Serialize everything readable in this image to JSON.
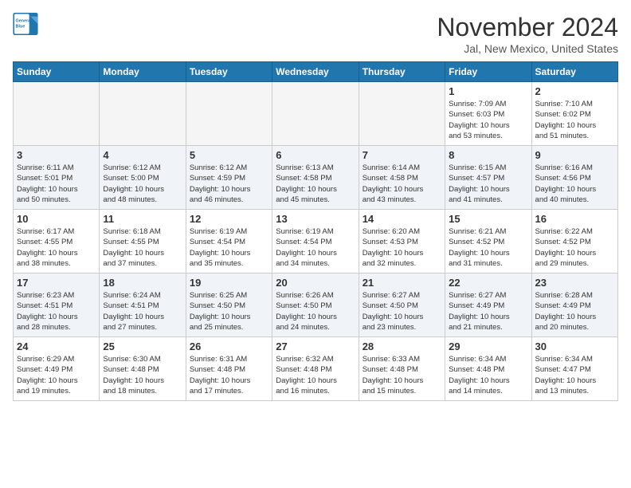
{
  "logo": {
    "line1": "General",
    "line2": "Blue"
  },
  "title": "November 2024",
  "subtitle": "Jal, New Mexico, United States",
  "days_of_week": [
    "Sunday",
    "Monday",
    "Tuesday",
    "Wednesday",
    "Thursday",
    "Friday",
    "Saturday"
  ],
  "weeks": [
    [
      {
        "day": "",
        "info": ""
      },
      {
        "day": "",
        "info": ""
      },
      {
        "day": "",
        "info": ""
      },
      {
        "day": "",
        "info": ""
      },
      {
        "day": "",
        "info": ""
      },
      {
        "day": "1",
        "info": "Sunrise: 7:09 AM\nSunset: 6:03 PM\nDaylight: 10 hours\nand 53 minutes."
      },
      {
        "day": "2",
        "info": "Sunrise: 7:10 AM\nSunset: 6:02 PM\nDaylight: 10 hours\nand 51 minutes."
      }
    ],
    [
      {
        "day": "3",
        "info": "Sunrise: 6:11 AM\nSunset: 5:01 PM\nDaylight: 10 hours\nand 50 minutes."
      },
      {
        "day": "4",
        "info": "Sunrise: 6:12 AM\nSunset: 5:00 PM\nDaylight: 10 hours\nand 48 minutes."
      },
      {
        "day": "5",
        "info": "Sunrise: 6:12 AM\nSunset: 4:59 PM\nDaylight: 10 hours\nand 46 minutes."
      },
      {
        "day": "6",
        "info": "Sunrise: 6:13 AM\nSunset: 4:58 PM\nDaylight: 10 hours\nand 45 minutes."
      },
      {
        "day": "7",
        "info": "Sunrise: 6:14 AM\nSunset: 4:58 PM\nDaylight: 10 hours\nand 43 minutes."
      },
      {
        "day": "8",
        "info": "Sunrise: 6:15 AM\nSunset: 4:57 PM\nDaylight: 10 hours\nand 41 minutes."
      },
      {
        "day": "9",
        "info": "Sunrise: 6:16 AM\nSunset: 4:56 PM\nDaylight: 10 hours\nand 40 minutes."
      }
    ],
    [
      {
        "day": "10",
        "info": "Sunrise: 6:17 AM\nSunset: 4:55 PM\nDaylight: 10 hours\nand 38 minutes."
      },
      {
        "day": "11",
        "info": "Sunrise: 6:18 AM\nSunset: 4:55 PM\nDaylight: 10 hours\nand 37 minutes."
      },
      {
        "day": "12",
        "info": "Sunrise: 6:19 AM\nSunset: 4:54 PM\nDaylight: 10 hours\nand 35 minutes."
      },
      {
        "day": "13",
        "info": "Sunrise: 6:19 AM\nSunset: 4:54 PM\nDaylight: 10 hours\nand 34 minutes."
      },
      {
        "day": "14",
        "info": "Sunrise: 6:20 AM\nSunset: 4:53 PM\nDaylight: 10 hours\nand 32 minutes."
      },
      {
        "day": "15",
        "info": "Sunrise: 6:21 AM\nSunset: 4:52 PM\nDaylight: 10 hours\nand 31 minutes."
      },
      {
        "day": "16",
        "info": "Sunrise: 6:22 AM\nSunset: 4:52 PM\nDaylight: 10 hours\nand 29 minutes."
      }
    ],
    [
      {
        "day": "17",
        "info": "Sunrise: 6:23 AM\nSunset: 4:51 PM\nDaylight: 10 hours\nand 28 minutes."
      },
      {
        "day": "18",
        "info": "Sunrise: 6:24 AM\nSunset: 4:51 PM\nDaylight: 10 hours\nand 27 minutes."
      },
      {
        "day": "19",
        "info": "Sunrise: 6:25 AM\nSunset: 4:50 PM\nDaylight: 10 hours\nand 25 minutes."
      },
      {
        "day": "20",
        "info": "Sunrise: 6:26 AM\nSunset: 4:50 PM\nDaylight: 10 hours\nand 24 minutes."
      },
      {
        "day": "21",
        "info": "Sunrise: 6:27 AM\nSunset: 4:50 PM\nDaylight: 10 hours\nand 23 minutes."
      },
      {
        "day": "22",
        "info": "Sunrise: 6:27 AM\nSunset: 4:49 PM\nDaylight: 10 hours\nand 21 minutes."
      },
      {
        "day": "23",
        "info": "Sunrise: 6:28 AM\nSunset: 4:49 PM\nDaylight: 10 hours\nand 20 minutes."
      }
    ],
    [
      {
        "day": "24",
        "info": "Sunrise: 6:29 AM\nSunset: 4:49 PM\nDaylight: 10 hours\nand 19 minutes."
      },
      {
        "day": "25",
        "info": "Sunrise: 6:30 AM\nSunset: 4:48 PM\nDaylight: 10 hours\nand 18 minutes."
      },
      {
        "day": "26",
        "info": "Sunrise: 6:31 AM\nSunset: 4:48 PM\nDaylight: 10 hours\nand 17 minutes."
      },
      {
        "day": "27",
        "info": "Sunrise: 6:32 AM\nSunset: 4:48 PM\nDaylight: 10 hours\nand 16 minutes."
      },
      {
        "day": "28",
        "info": "Sunrise: 6:33 AM\nSunset: 4:48 PM\nDaylight: 10 hours\nand 15 minutes."
      },
      {
        "day": "29",
        "info": "Sunrise: 6:34 AM\nSunset: 4:48 PM\nDaylight: 10 hours\nand 14 minutes."
      },
      {
        "day": "30",
        "info": "Sunrise: 6:34 AM\nSunset: 4:47 PM\nDaylight: 10 hours\nand 13 minutes."
      }
    ]
  ]
}
